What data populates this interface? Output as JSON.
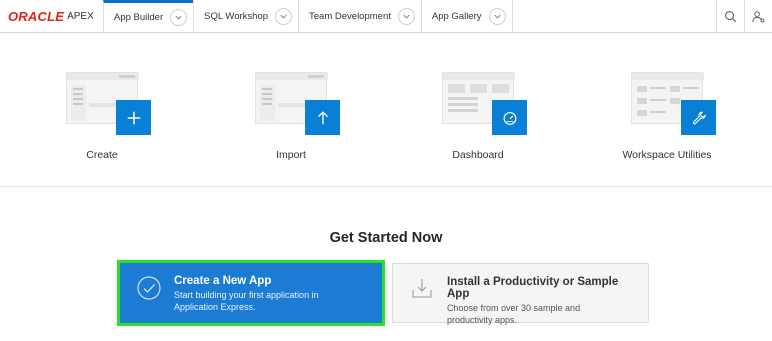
{
  "header": {
    "brand": "ORACLE",
    "product": "APEX",
    "tabs": [
      {
        "label": "App Builder"
      },
      {
        "label": "SQL Workshop"
      },
      {
        "label": "Team Development"
      },
      {
        "label": "App Gallery"
      }
    ],
    "active_tab": "App Builder"
  },
  "tiles": [
    {
      "label": "Create",
      "icon": "plus-icon"
    },
    {
      "label": "Import",
      "icon": "upload-arrow-icon"
    },
    {
      "label": "Dashboard",
      "icon": "gauge-icon"
    },
    {
      "label": "Workspace Utilities",
      "icon": "wrench-icon"
    }
  ],
  "get_started": {
    "title": "Get Started Now",
    "primary": {
      "title": "Create a New App",
      "line1": "Start building your first application in",
      "line2": "Application Express."
    },
    "secondary": {
      "title": "Install a Productivity or Sample App",
      "line1": "Choose from over 30 sample and",
      "line2": "productivity apps."
    }
  },
  "colors": {
    "accent": "#0a7fd6",
    "primary_card": "#1c7bd3",
    "highlight_outline": "#2be02b",
    "brand_red": "#e2231a"
  }
}
